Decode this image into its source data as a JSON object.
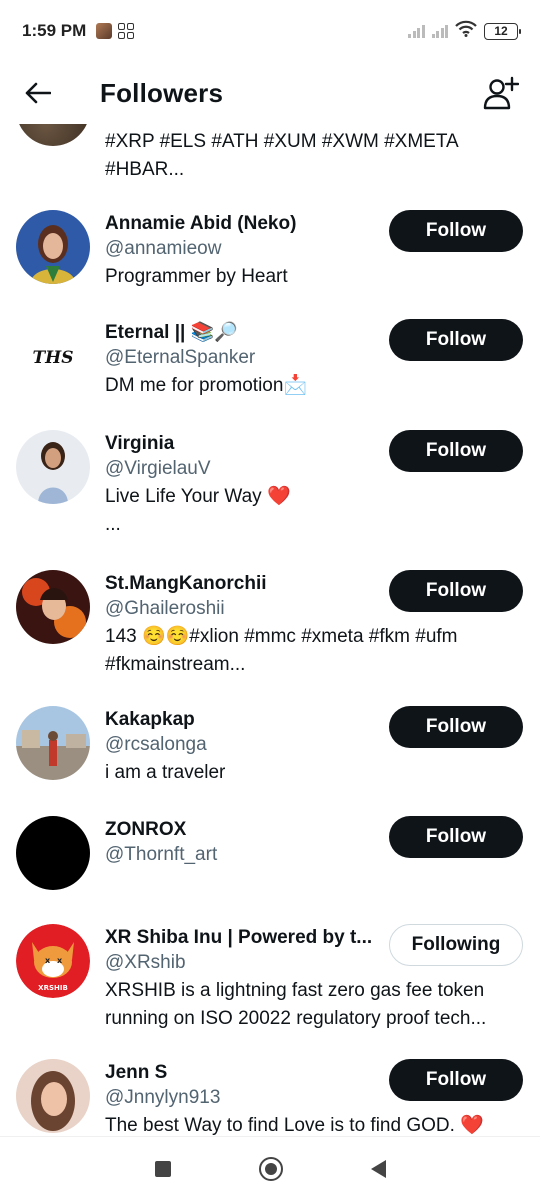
{
  "status_bar": {
    "time": "1:59 PM",
    "battery": "12",
    "icons": [
      "app-thumbnail-icon",
      "grid-app-icon",
      "signal-icon",
      "signal-icon",
      "wifi-icon",
      "battery-icon"
    ]
  },
  "header": {
    "title": "Followers",
    "back_icon": "arrow-left-icon",
    "add_icon": "add-user-icon"
  },
  "partial": {
    "bio_line1": "#XRP #ELS #ATH #XUM #XWM #XMETA",
    "bio_line2": "#HBAR..."
  },
  "followers": [
    {
      "name": "Annamie Abid (Neko)",
      "handle": "@annamieow",
      "bio": "Programmer by Heart",
      "bio2": "",
      "button": "Follow"
    },
    {
      "name": "Eternal || 📚🔎",
      "handle": "@EternalSpanker",
      "bio": "DM me for promotion📩",
      "bio2": "",
      "button": "Follow"
    },
    {
      "name": "Virginia",
      "handle": "@VirgielauV",
      "bio": "Live Life Your Way ❤️",
      "bio2": "...",
      "button": "Follow"
    },
    {
      "name": "St.MangKanorchii",
      "handle": "@Ghaileroshii",
      "bio": "143 ☺️☺️#xlion #mmc #xmeta #fkm #ufm",
      "bio2": "#fkmainstream...",
      "button": "Follow"
    },
    {
      "name": "Kakapkap",
      "handle": "@rcsalonga",
      "bio": "i am a traveler",
      "bio2": "",
      "button": "Follow"
    },
    {
      "name": "ZONROX",
      "handle": "@Thornft_art",
      "bio": "",
      "bio2": "",
      "button": "Follow"
    },
    {
      "name": "XR Shiba Inu | Powered by t...",
      "handle": "@XRshib",
      "bio": "XRSHIB is a lightning fast zero gas fee token",
      "bio2": "running on ISO 20022 regulatory proof tech...",
      "button": "Following"
    },
    {
      "name": "Jenn S",
      "handle": "@Jnnylyn913",
      "bio": "The best Way to find Love is to find GOD. ❤️",
      "bio2": "",
      "button": "Follow"
    }
  ],
  "avatar_text": {
    "eternal_logo": "THS",
    "xrshib_logo": "XRSHIB"
  },
  "colors": {
    "primary_text": "#0f1419",
    "secondary_text": "#536471",
    "follow_button": "#0f1419",
    "following_border": "#cfd9de"
  },
  "navbar": {
    "icons": [
      "recents-square-icon",
      "home-circle-icon",
      "back-triangle-icon"
    ]
  }
}
